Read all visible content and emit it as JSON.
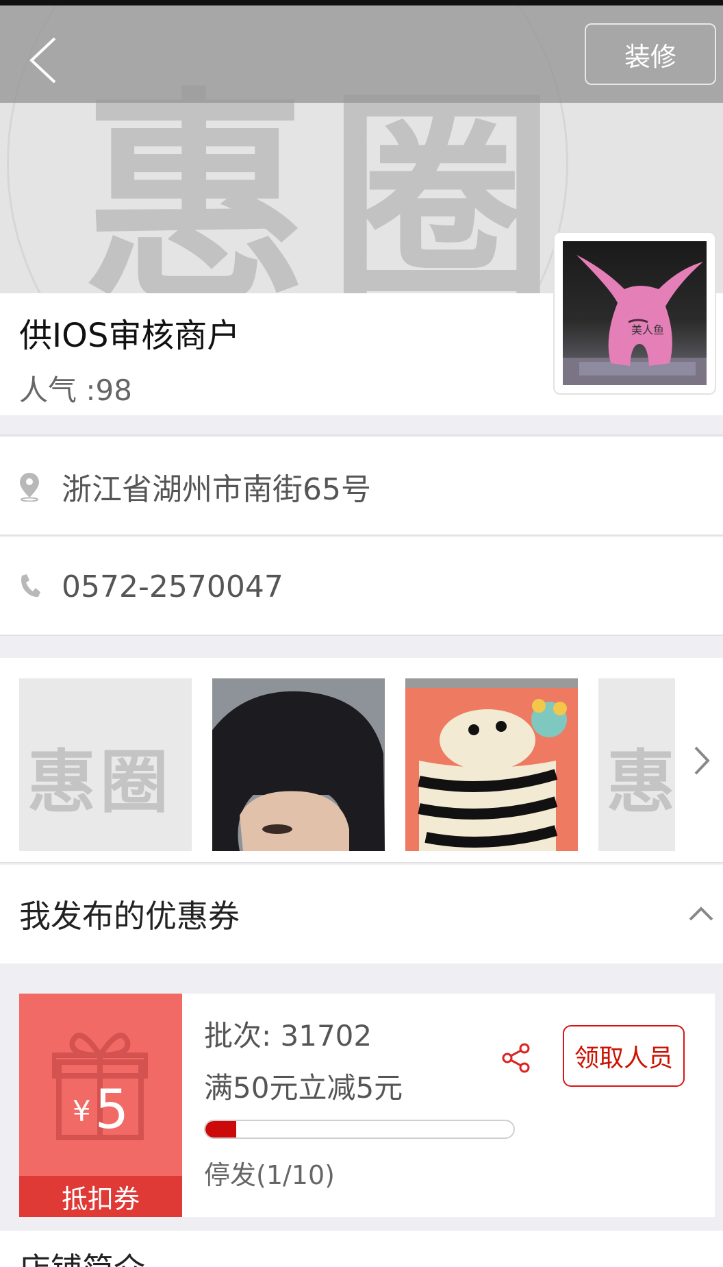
{
  "navbar": {
    "back_icon": "chevron-left-icon",
    "decorate_label": "装修"
  },
  "hero": {
    "watermark": "惠圈"
  },
  "store": {
    "name": "供IOS审核商户",
    "popularity": "人气 :98"
  },
  "contact": {
    "address_icon": "location-pin-icon",
    "address": "浙江省湖州市南街65号",
    "phone_icon": "phone-icon",
    "phone": "0572-2570047"
  },
  "gallery": {
    "placeholder_watermark": "惠圈",
    "next_icon": "chevron-right-icon"
  },
  "coupons_section": {
    "title": "我发布的优惠券",
    "toggle_icon": "chevron-up-icon"
  },
  "coupon": {
    "currency": "¥",
    "amount": "5",
    "type": "抵扣券",
    "batch": "批次: 31702",
    "rule": "满50元立减5元",
    "progress_fraction": 0.1,
    "status": "停发(1/10)",
    "share_icon": "share-icon",
    "receivers_label": "领取人员",
    "accent_color": "#cc0a0a"
  },
  "intro": {
    "title": "店铺简介"
  }
}
